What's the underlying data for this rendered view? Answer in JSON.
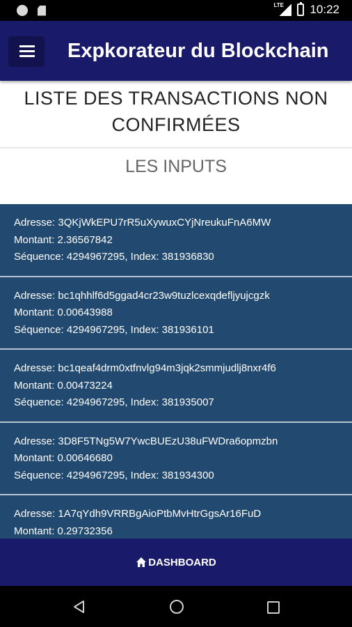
{
  "status_bar": {
    "time": "10:22",
    "network": "LTE",
    "icons": [
      "circle-icon",
      "sd-card-icon",
      "signal-icon",
      "battery-icon"
    ]
  },
  "app_bar": {
    "title": "Expkorateur du Blockchain",
    "menu_icon": "hamburger-menu-icon",
    "background": "#1a1a6b"
  },
  "page": {
    "title": "LISTE DES TRANSACTIONS NON CONFIRMÉES",
    "section_title": "LES INPUTS"
  },
  "inputs": [
    {
      "address_label": "Adresse: 3QKjWkEPU7rR5uXywuxCYjNreukuFnA6MW",
      "amount_label": "Montant: 2.36567842",
      "sequence_label": "Séquence: 4294967295, Index: 381936830"
    },
    {
      "address_label": "Adresse: bc1qhhlf6d5ggad4cr23w9tuzlcexqdefljyujcgzk",
      "amount_label": "Montant: 0.00643988",
      "sequence_label": "Séquence: 4294967295, Index: 381936101"
    },
    {
      "address_label": "Adresse: bc1qeaf4drm0xtfnvlg94m3jqk2smmjudlj8nxr4f6",
      "amount_label": "Montant: 0.00473224",
      "sequence_label": "Séquence: 4294967295, Index: 381935007"
    },
    {
      "address_label": "Adresse: 3D8F5TNg5W7YwcBUEzU38uFWDra6opmzbn",
      "amount_label": "Montant: 0.00646680",
      "sequence_label": "Séquence: 4294967295, Index: 381934300"
    },
    {
      "address_label": "Adresse: 1A7qYdh9VRRBgAioPtbMvHtrGgsAr16FuD",
      "amount_label": "Montant: 0.29732356",
      "sequence_label": ""
    }
  ],
  "bottom_bar": {
    "dashboard_label": "DASHBOARD",
    "dashboard_icon": "home-icon"
  },
  "nav_bar": {
    "icons": [
      "back-icon",
      "home-circle-icon",
      "recents-icon"
    ]
  },
  "colors": {
    "primary": "#1a1a6b",
    "list_background": "#22496f",
    "list_divider": "#b8c4d1"
  }
}
